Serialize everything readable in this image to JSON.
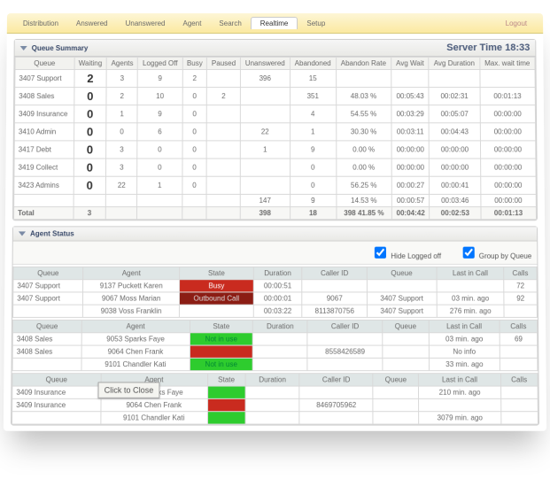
{
  "tabs": {
    "items": [
      "Distribution",
      "Answered",
      "Unanswered",
      "Agent",
      "Search",
      "Realtime",
      "Setup"
    ],
    "active": 5,
    "logout": "Logout"
  },
  "serverTime": {
    "label": "Server Time",
    "value": "18:33"
  },
  "queueSummary": {
    "title": "Queue Summary",
    "headers": [
      "Queue",
      "Waiting",
      "Agents",
      "Logged Off",
      "Busy",
      "Paused",
      "Unanswered",
      "Abandoned",
      "Abandon Rate",
      "Avg Wait",
      "Avg Duration",
      "Max. wait time"
    ],
    "rows": [
      {
        "q": "3407 Support",
        "waiting": "2",
        "agents": "3",
        "loggedOff": "9",
        "busy": "2",
        "paused": "",
        "un": "396",
        "ab": "15",
        "ar": "",
        "aw": "",
        "ad": "",
        "mw": ""
      },
      {
        "q": "3408 Sales",
        "waiting": "0",
        "agents": "2",
        "loggedOff": "10",
        "busy": "0",
        "paused": "2",
        "un": "",
        "ab": "351",
        "ar": "48.03 %",
        "aw": "00:05:43",
        "ad": "00:02:31",
        "mw": "00:01:13"
      },
      {
        "q": "3409 Insurance",
        "waiting": "0",
        "agents": "1",
        "loggedOff": "9",
        "busy": "0",
        "paused": "",
        "un": "",
        "ab": "4",
        "ar": "54.55 %",
        "aw": "00:03:29",
        "ad": "00:05:07",
        "mw": "00:00:00"
      },
      {
        "q": "3410 Admin",
        "waiting": "0",
        "agents": "0",
        "loggedOff": "6",
        "busy": "0",
        "paused": "",
        "un": "22",
        "ab": "1",
        "ar": "30.30 %",
        "aw": "00:03:11",
        "ad": "00:04:43",
        "mw": "00:00:00"
      },
      {
        "q": "3417 Debt",
        "waiting": "0",
        "agents": "3",
        "loggedOff": "0",
        "busy": "0",
        "paused": "",
        "un": "1",
        "ab": "9",
        "ar": "0.00 %",
        "aw": "00:00:00",
        "ad": "00:00:00",
        "mw": "00:00:00"
      },
      {
        "q": "3419 Collect",
        "waiting": "0",
        "agents": "3",
        "loggedOff": "0",
        "busy": "0",
        "paused": "",
        "un": "",
        "ab": "0",
        "ar": "0.00 %",
        "aw": "00:00:00",
        "ad": "00:00:00",
        "mw": "00:00:00"
      },
      {
        "q": "3423 Admins",
        "waiting": "0",
        "agents": "22",
        "loggedOff": "1",
        "busy": "0",
        "paused": "",
        "un": "",
        "ab": "0",
        "ar": "56.25 %",
        "aw": "00:00:27",
        "ad": "00:00:41",
        "mw": "00:00:00"
      },
      {
        "q": "",
        "waiting": "",
        "agents": "",
        "loggedOff": "",
        "busy": "",
        "paused": "",
        "un": "147",
        "ab": "9",
        "ar": "14.53 %",
        "aw": "00:00:57",
        "ad": "00:03:46",
        "mw": "00:00:00"
      }
    ],
    "totals": {
      "q": "Total",
      "waiting": "3",
      "agents": "",
      "loggedOff": "",
      "busy": "",
      "paused": "",
      "un": "398",
      "ab": "18",
      "ar": "398     41.85 %",
      "aw": "00:04:42",
      "ad": "00:02:53",
      "mw": "00:01:13"
    }
  },
  "agentStatus": {
    "title": "Agent Status",
    "opts": {
      "hide": "Hide Logged off",
      "group": "Group by Queue"
    },
    "cols": [
      "Queue",
      "Agent",
      "State",
      "Duration",
      "Caller ID",
      "Queue",
      "Last in Call",
      "Calls"
    ],
    "sections": [
      {
        "queue": "3407 Support",
        "rows": [
          {
            "q": "3407 Support",
            "agent": "9137 Puckett Karen",
            "state": "busy",
            "stateTxt": "Busy",
            "dur": "00:00:51",
            "cid": "",
            "q2": "",
            "last": "",
            "calls": "72"
          },
          {
            "q": "3407 Support",
            "agent": "9067 Moss Marian",
            "state": "offline",
            "stateTxt": "Outbound Call",
            "dur": "00:00:01",
            "cid": "9067",
            "q2": "3407 Support",
            "last": "03 min. ago",
            "calls": "92"
          },
          {
            "q": "",
            "agent": "9038 Voss Franklin",
            "state": "",
            "stateTxt": "",
            "dur": "00:03:22",
            "cid": "8113870756",
            "q2": "3407 Support",
            "last": "276 min. ago",
            "calls": ""
          }
        ]
      },
      {
        "queue": "3408 Sales",
        "rows": [
          {
            "q": "3408 Sales",
            "agent": "9053 Sparks Faye",
            "state": "free",
            "stateTxt": "Not in use",
            "dur": "",
            "cid": "",
            "q2": "",
            "last": "03 min. ago",
            "calls": "69"
          },
          {
            "q": "3408 Sales",
            "agent": "9064 Chen Frank",
            "state": "busy",
            "stateTxt": "",
            "dur": "",
            "cid": "8558426589",
            "q2": "",
            "last": "No info",
            "calls": ""
          },
          {
            "q": "",
            "agent": "9101 Chandler Kati",
            "state": "free",
            "stateTxt": "Not in use",
            "dur": "",
            "cid": "",
            "q2": "",
            "last": "33 min. ago",
            "calls": ""
          }
        ]
      },
      {
        "queue": "3409 Insurance",
        "rows": [
          {
            "q": "3409 Insurance",
            "agent": "9053 Sparks Faye",
            "state": "free",
            "stateTxt": "",
            "dur": "",
            "cid": "",
            "q2": "",
            "last": "210 min. ago",
            "calls": ""
          },
          {
            "q": "3409 Insurance",
            "agent": "9064 Chen Frank",
            "state": "busy",
            "stateTxt": "",
            "dur": "",
            "cid": "8469705962",
            "q2": "",
            "last": "",
            "calls": ""
          },
          {
            "q": "",
            "agent": "9101 Chandler Kati",
            "state": "free",
            "stateTxt": "",
            "dur": "",
            "cid": "",
            "q2": "",
            "last": "3079 min. ago",
            "calls": ""
          }
        ]
      }
    ]
  },
  "tooltip": "Click to Close"
}
